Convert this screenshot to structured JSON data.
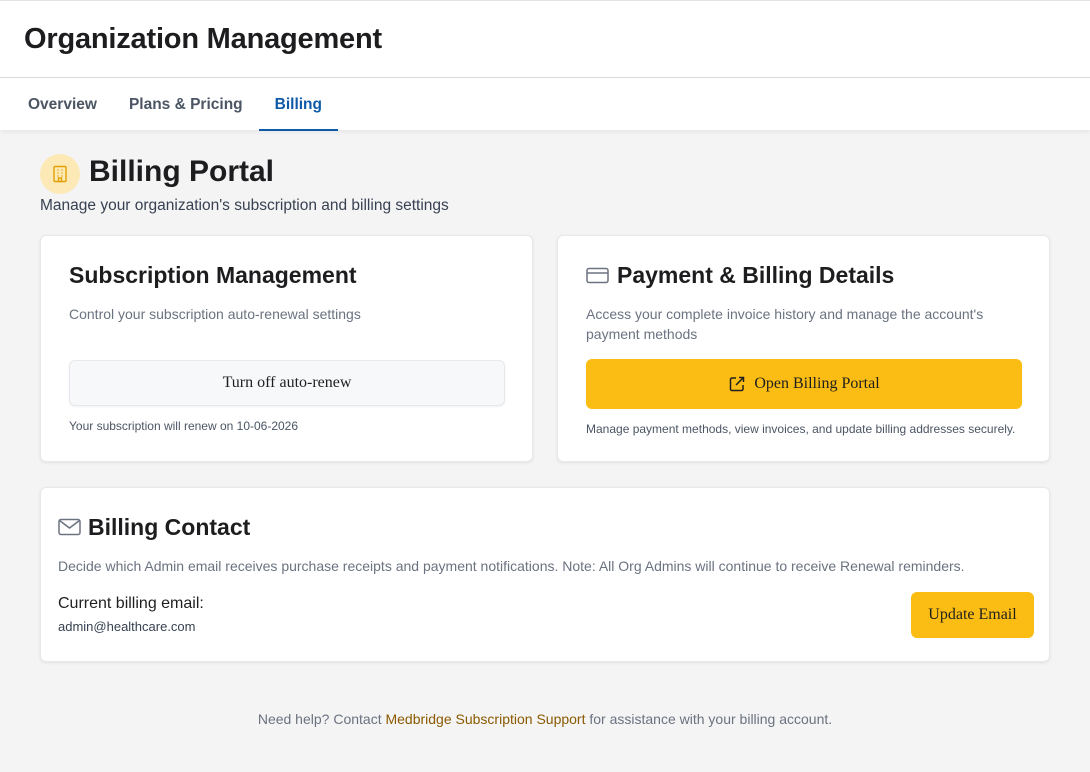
{
  "header": {
    "title": "Organization Management",
    "tabs": [
      {
        "label": "Overview",
        "active": false
      },
      {
        "label": "Plans & Pricing",
        "active": false
      },
      {
        "label": "Billing",
        "active": true
      }
    ]
  },
  "page": {
    "icon": "building-icon",
    "title": "Billing Portal",
    "subtitle": "Manage your organization's subscription and billing settings"
  },
  "subscription": {
    "title": "Subscription Management",
    "description": "Control your subscription auto-renewal settings",
    "button_label": "Turn off auto-renew",
    "renew_note": "Your subscription will renew on 10-06-2026"
  },
  "payment": {
    "icon": "credit-card-icon",
    "title": "Payment & Billing Details",
    "description": "Access your complete invoice history and manage the account's payment methods",
    "button_icon": "external-link-icon",
    "button_label": "Open Billing Portal",
    "note": "Manage payment methods, view invoices, and update billing addresses securely."
  },
  "contact": {
    "icon": "mail-icon",
    "title": "Billing Contact",
    "description": "Decide which Admin email receives purchase receipts and payment notifications. Note: All Org Admins will continue to receive Renewal reminders.",
    "email_label": "Current billing email:",
    "email_value": "admin@healthcare.com",
    "button_label": "Update Email"
  },
  "footer": {
    "prefix": "Need help? Contact ",
    "link_text": "Medbridge Subscription Support",
    "suffix": " for assistance with your billing account."
  },
  "colors": {
    "accent": "#fbbd14",
    "tab_active": "#0f5aa8",
    "link": "#8a5a00"
  }
}
